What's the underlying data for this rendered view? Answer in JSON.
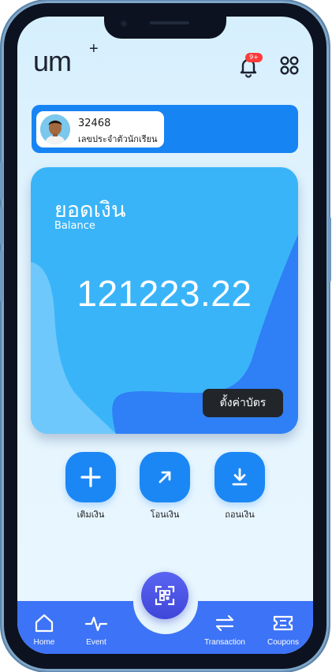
{
  "header": {
    "logo_text": "um",
    "logo_plus": "+",
    "notification_badge": "9+"
  },
  "student": {
    "id": "32468",
    "label": "เลขประจำตัวนักเรียน"
  },
  "balance": {
    "title": "ยอดเงิน",
    "subtitle": "Balance",
    "amount": "121223.22",
    "settings_button": "ตั้งค่าบัตร"
  },
  "actions": [
    {
      "label": "เติมเงิน",
      "icon": "plus-icon"
    },
    {
      "label": "โอนเงิน",
      "icon": "arrow-up-right-icon"
    },
    {
      "label": "ถอนเงิน",
      "icon": "download-icon"
    }
  ],
  "bottom_nav": {
    "items": [
      {
        "label": "Home",
        "icon": "home-icon"
      },
      {
        "label": "Event",
        "icon": "pulse-icon"
      },
      {
        "label": "Transaction",
        "icon": "transfer-arrows-icon"
      },
      {
        "label": "Coupons",
        "icon": "ticket-icon"
      }
    ],
    "center_icon": "qr-scan-icon"
  },
  "colors": {
    "primary": "#1784f3",
    "nav": "#3d73f6",
    "scan": "#4c54e6",
    "card_light": "#3ab4f8",
    "card_dark": "#2f7ff6",
    "badge": "#ff3b3b"
  }
}
